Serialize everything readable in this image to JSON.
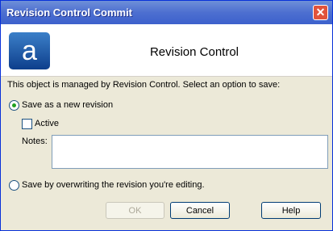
{
  "window": {
    "title": "Revision Control Commit"
  },
  "header": {
    "logo_letter": "a",
    "title": "Revision Control"
  },
  "body": {
    "intro": "This object is managed by Revision Control.  Select an option to save:",
    "option_new": "Save as a new revision",
    "active_label": "Active",
    "notes_label": "Notes:",
    "option_overwrite": "Save by overwriting the revision you're editing."
  },
  "buttons": {
    "ok": "OK",
    "cancel": "Cancel",
    "help": "Help"
  }
}
